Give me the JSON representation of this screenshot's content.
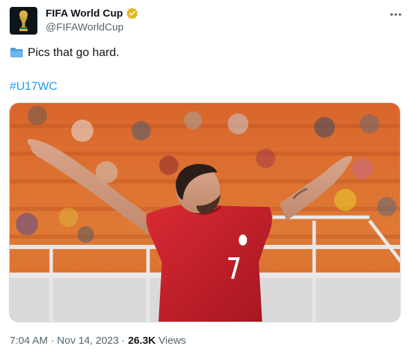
{
  "author": {
    "display_name": "FIFA World Cup",
    "handle": "@FIFAWorldCup",
    "verified_badge_color": "#e2b719",
    "avatar_icon": "fifa-world-cup-logo-icon"
  },
  "tweet": {
    "text": "Pics that go hard.",
    "text_icon": "folder-icon",
    "hashtag": "#U17WC"
  },
  "meta": {
    "time": "7:04 AM",
    "separator": " · ",
    "date": "Nov 14, 2023",
    "views_count": "26.3K",
    "views_label": "Views"
  },
  "colors": {
    "link": "#1d9bf0",
    "secondary_text": "#536471",
    "jersey": "#c8202c"
  }
}
